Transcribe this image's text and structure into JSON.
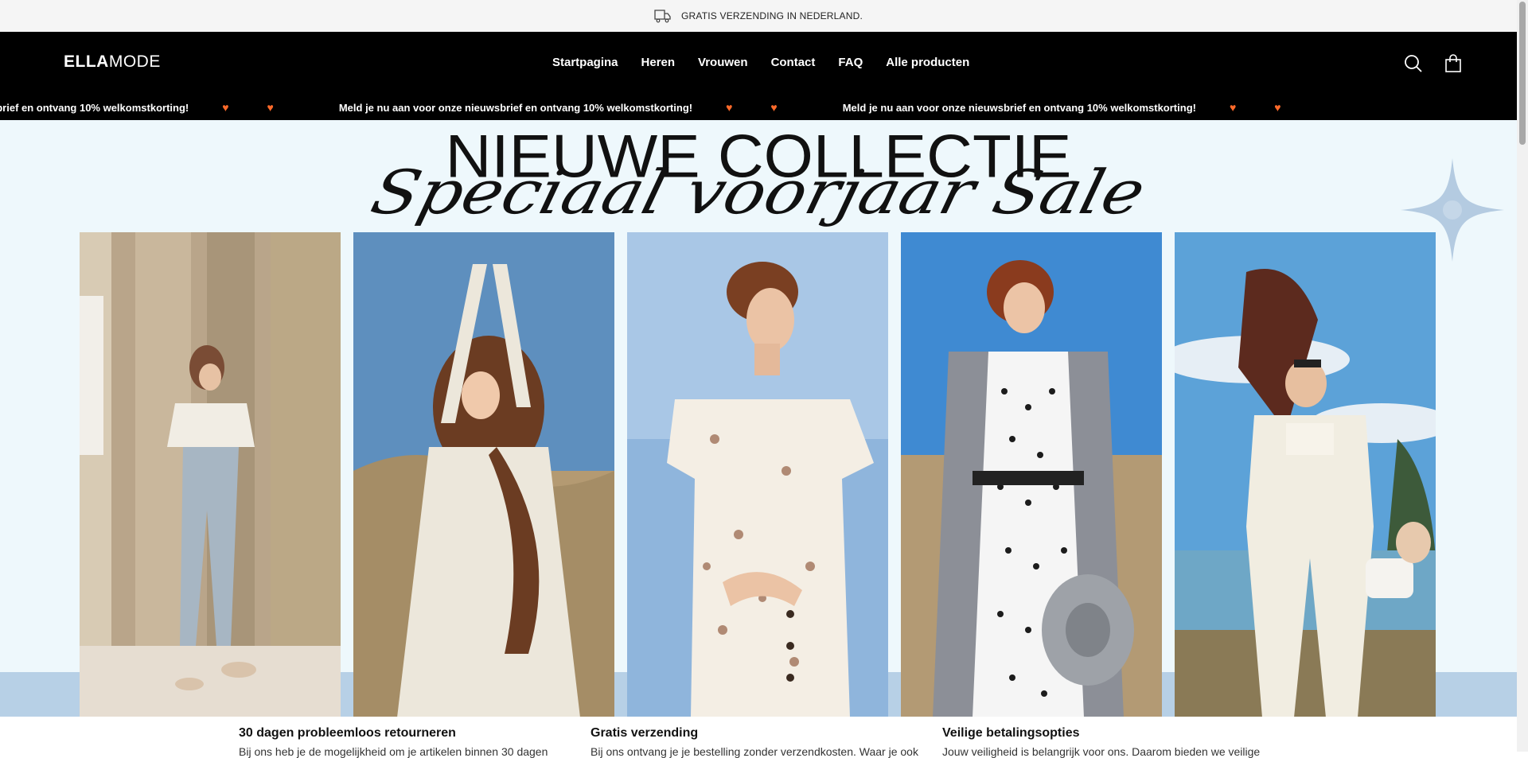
{
  "announcement": {
    "text": "GRATIS VERZENDING IN NEDERLAND.",
    "icon": "truck-icon"
  },
  "header": {
    "logo": {
      "part1": "ELLA",
      "part2": "MODE"
    },
    "nav": [
      "Startpagina",
      "Heren",
      "Vrouwen",
      "Contact",
      "FAQ",
      "Alle producten"
    ],
    "icons": [
      "search-icon",
      "bag-icon"
    ]
  },
  "marquee": {
    "text": "Meld je nu aan voor onze nieuwsbrief en ontvang 10% welkomstkorting!",
    "partial_text": "sbrief en ontvang 10% welkomstkorting!",
    "accent": "#ff6a2a"
  },
  "hero": {
    "title": "NIEUWE COLLECTIE",
    "subtitle": "Speciaal voorjaar Sale",
    "background": "#eef8fc",
    "band_color": "#b7d0e6",
    "photos": [
      {
        "name": "model-cream-blouse-jeans-photo"
      },
      {
        "name": "model-white-dress-arms-up-photo"
      },
      {
        "name": "model-floral-dress-photo"
      },
      {
        "name": "model-polka-dot-dress-trench-photo"
      },
      {
        "name": "model-white-suit-scarf-photo"
      }
    ]
  },
  "features": [
    {
      "title": "30 dagen probleemloos retourneren",
      "text": "Bij ons heb je de mogelijkheid om je artikelen binnen 30 dagen"
    },
    {
      "title": "Gratis verzending",
      "text": "Bij ons ontvang je je bestelling zonder verzendkosten. Waar je ook"
    },
    {
      "title": "Veilige betalingsopties",
      "text": "Jouw veiligheid is belangrijk voor ons. Daarom bieden we veilige"
    }
  ]
}
